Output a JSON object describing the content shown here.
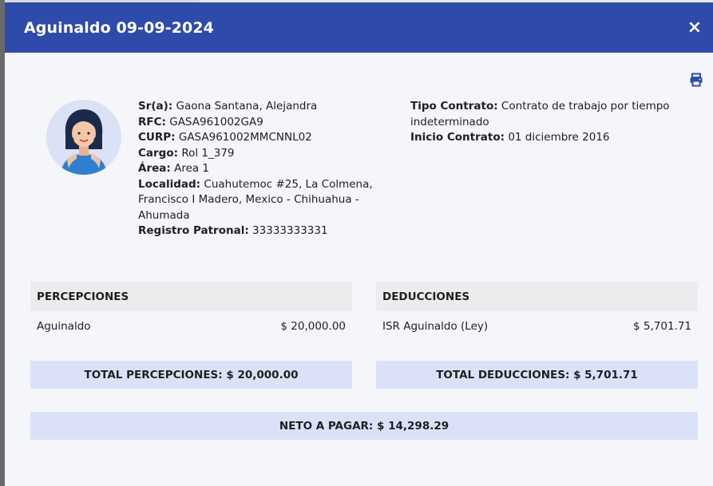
{
  "modal": {
    "title": "Aguinaldo 09-09-2024",
    "close_glyph": "×"
  },
  "employee": {
    "name_label": "Sr(a):",
    "name": "Gaona Santana, Alejandra",
    "rfc_label": "RFC:",
    "rfc": "GASA961002GA9",
    "curp_label": "CURP:",
    "curp": "GASA961002MMCNNL02",
    "cargo_label": "Cargo:",
    "cargo": "Rol 1_379",
    "area_label": "Área:",
    "area": "Area 1",
    "localidad_label": "Localidad:",
    "localidad": "Cuahutemoc #25, La Colmena, Francisco I Madero, Mexico - Chihuahua - Ahumada",
    "registro_label": "Registro Patronal:",
    "registro": "33333333331",
    "tipo_contrato_label": "Tipo Contrato:",
    "tipo_contrato": "Contrato de trabajo por tiempo indeterminado",
    "inicio_contrato_label": "Inicio Contrato:",
    "inicio_contrato": "01 diciembre 2016"
  },
  "percepciones": {
    "header": "PERCEPCIONES",
    "items": [
      {
        "concept": "Aguinaldo",
        "amount": "$ 20,000.00"
      }
    ],
    "total": "TOTAL PERCEPCIONES: $ 20,000.00"
  },
  "deducciones": {
    "header": "DEDUCCIONES",
    "items": [
      {
        "concept": "ISR Aguinaldo (Ley)",
        "amount": "$ 5,701.71"
      }
    ],
    "total": "TOTAL DEDUCCIONES: $ 5,701.71"
  },
  "neto": "NETO A PAGAR: $ 14,298.29",
  "icons": [
    "close-icon",
    "print-icon",
    "avatar-icon"
  ],
  "colors": {
    "header": "#2e4bac",
    "total_bg": "#dbe2f8",
    "panel_bg": "#f5f6f9"
  }
}
